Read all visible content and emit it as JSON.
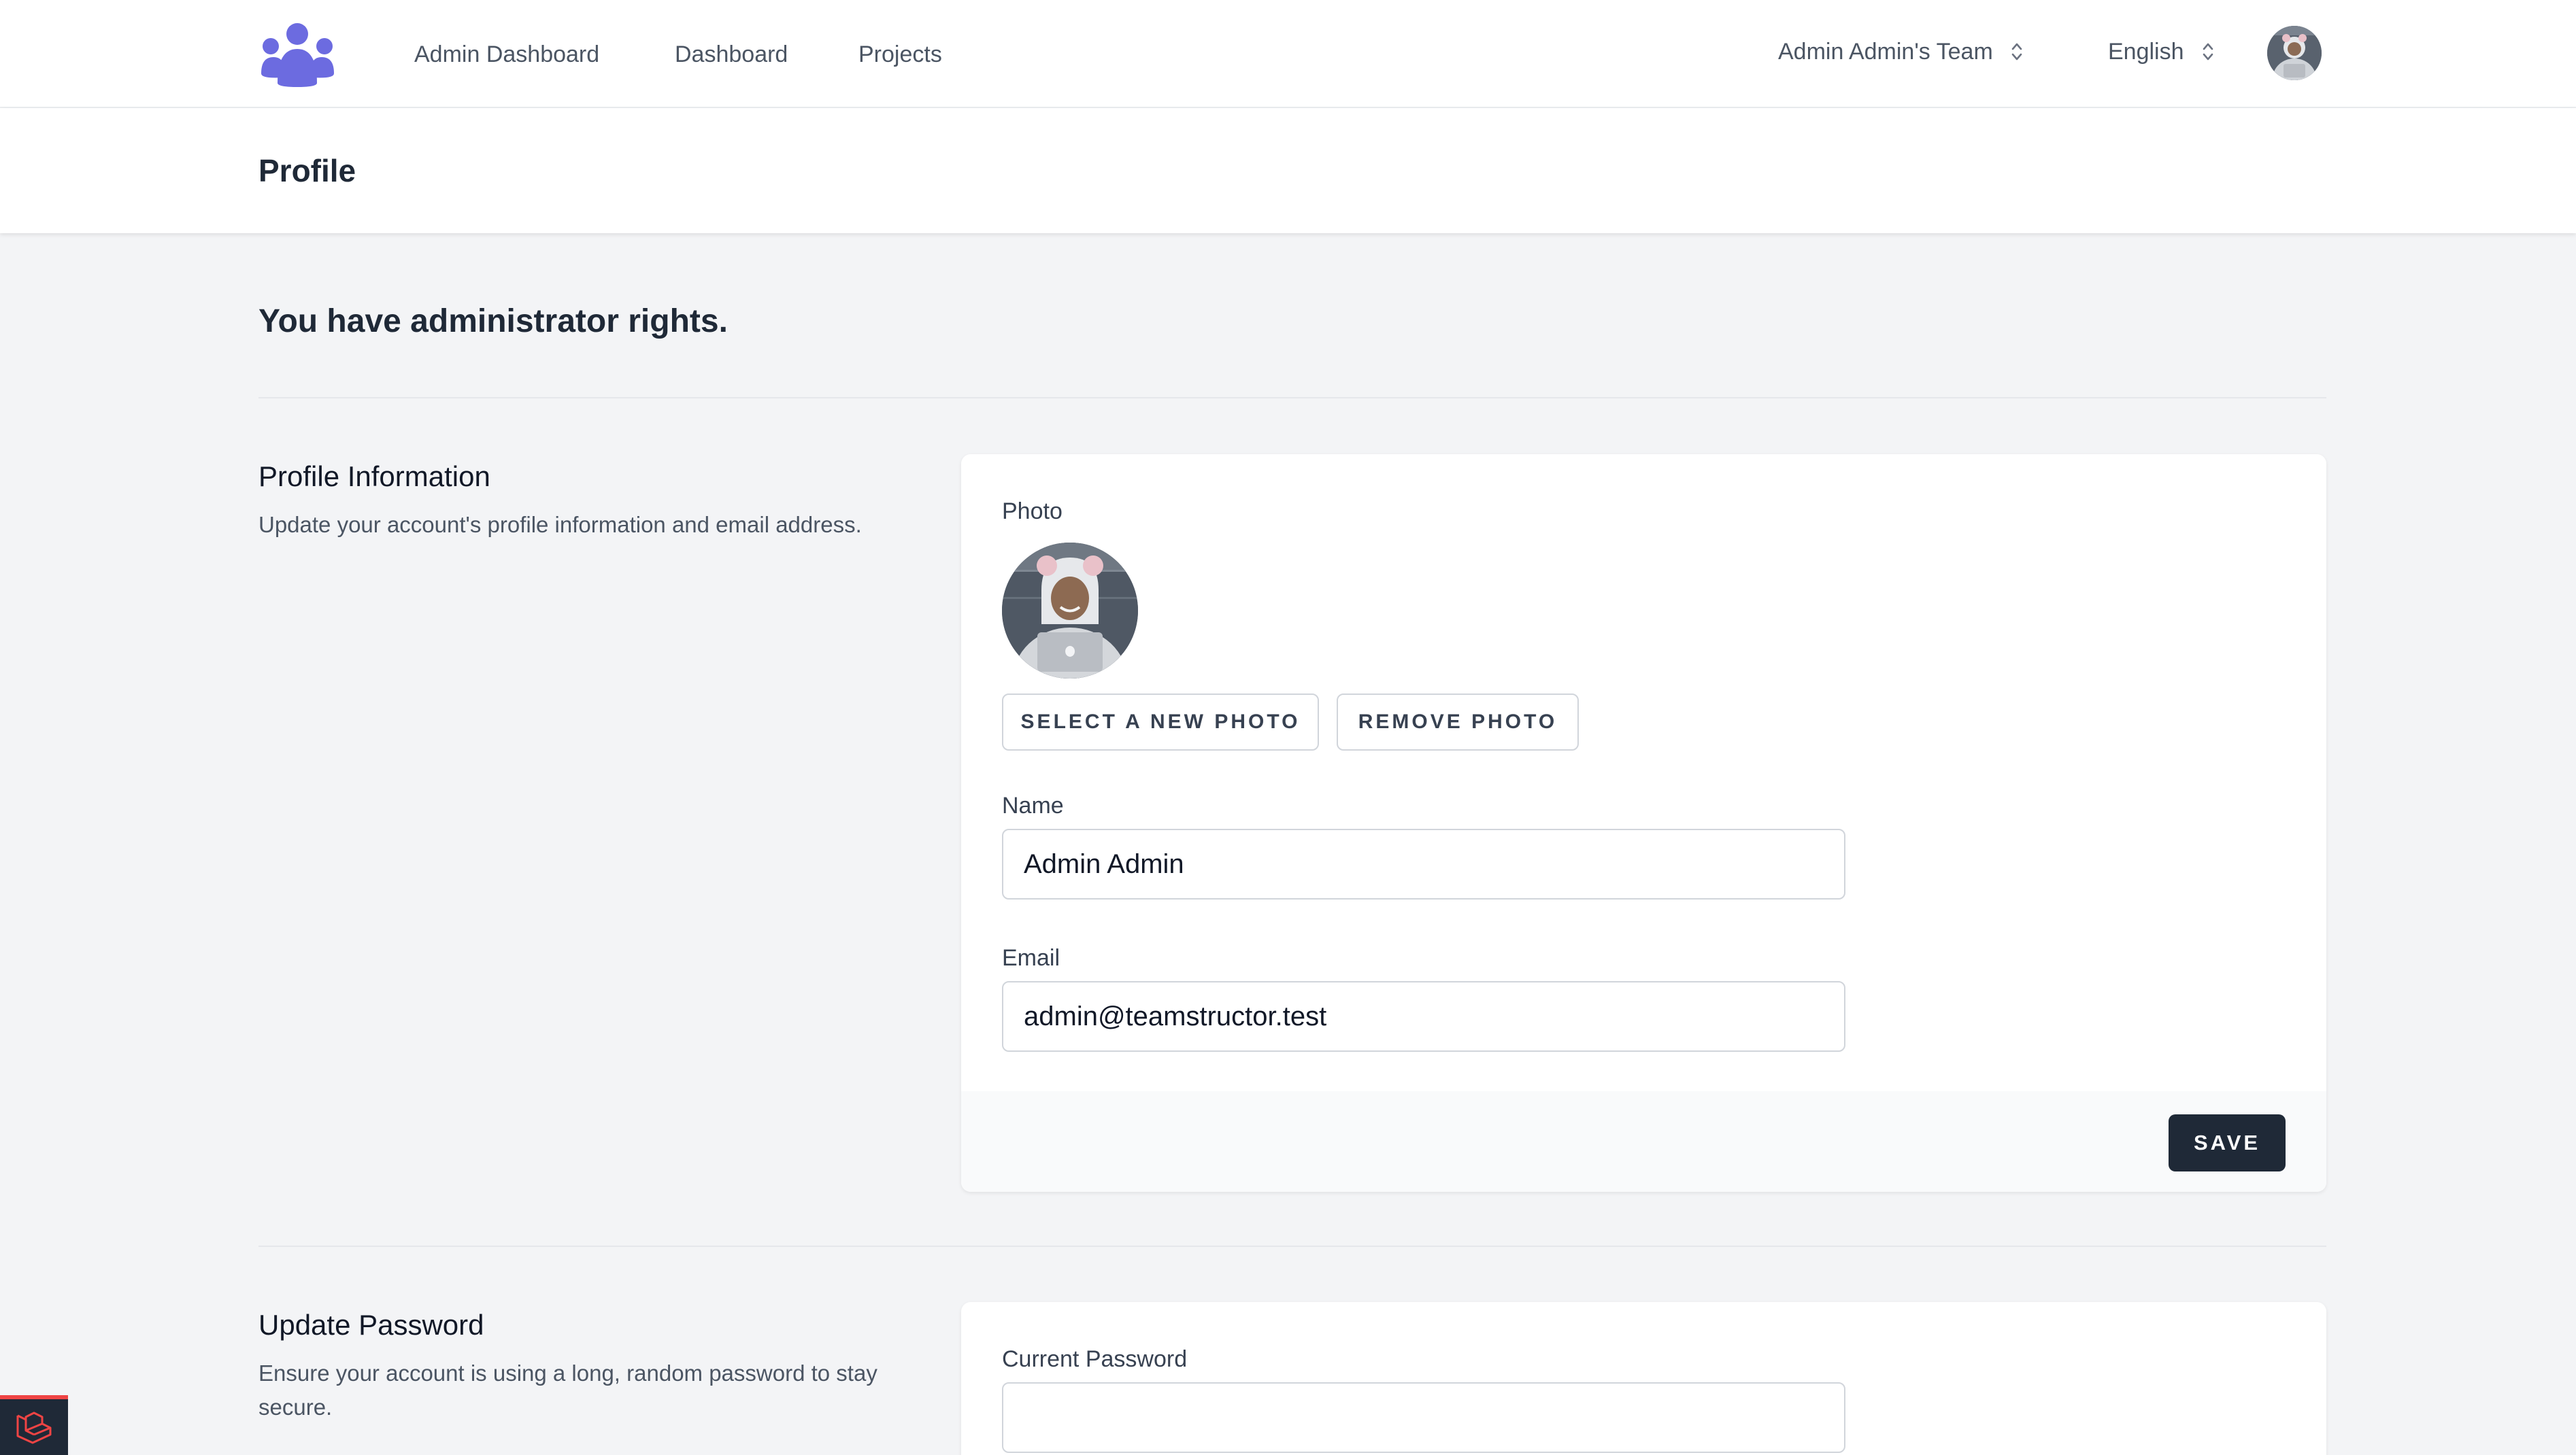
{
  "nav": {
    "links": [
      "Admin Dashboard",
      "Dashboard",
      "Projects"
    ],
    "team_label": "Admin Admin's Team",
    "language_label": "English"
  },
  "header": {
    "title": "Profile"
  },
  "main": {
    "admin_note": "You have administrator rights.",
    "profile_info": {
      "title": "Profile Information",
      "description": "Update your account's profile information and email address.",
      "photo_label": "Photo",
      "select_photo_button": "Select a new photo",
      "remove_photo_button": "Remove photo",
      "name_label": "Name",
      "name_value": "Admin Admin",
      "email_label": "Email",
      "email_value": "admin@teamstructor.test",
      "save_button": "SAVE"
    },
    "update_password": {
      "title": "Update Password",
      "description": "Ensure your account is using a long, random password to stay secure.",
      "current_password_label": "Current Password",
      "current_password_value": ""
    }
  },
  "colors": {
    "logo": "#6c6be0",
    "primary_button": "#1f2937",
    "page_background": "#f3f4f6",
    "laravel_red": "#ef4444"
  },
  "icons": {
    "logo": "people-group-icon",
    "dropdown": "chevron-up-down-icon",
    "debugbar": "laravel-icon"
  }
}
